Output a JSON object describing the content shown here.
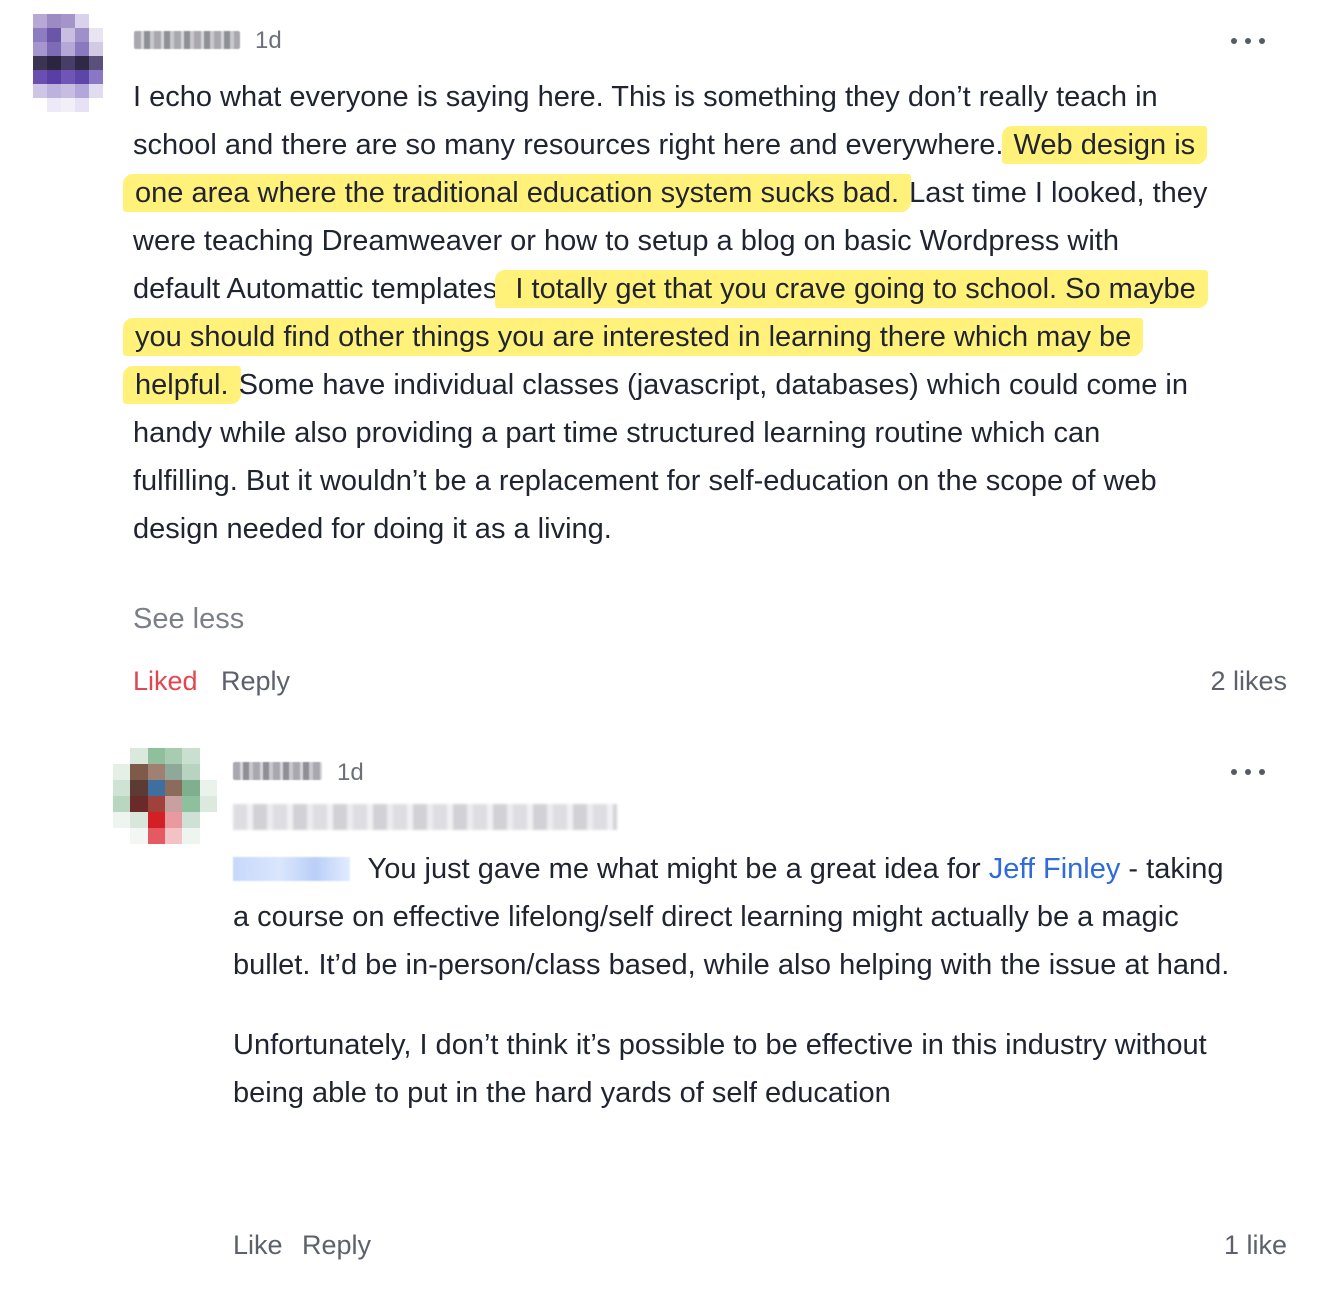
{
  "comments": [
    {
      "timestamp": "1d",
      "body": {
        "p1": "I echo what everyone is saying here. This is something they don’t really teach in school and there are so many resources right here and everywhere. ",
        "h1": "Web design is one area where the traditional education system sucks bad.",
        "p2": " Last time I looked, they were teaching Dreamweaver or how to setup a blog on basic Wordpress with default Automattic templates.",
        "h2": " I totally get that you crave going to school. So maybe you should find other things you are interested in learning there which may be helpful.",
        "p3": " Some have individual classes (javascript, databases) which could come in handy while also providing a part time structured learning routine which can fulfilling. But it wouldn’t be a replacement for self-education on the scope of web design needed for doing it as a living."
      },
      "see_less": "See less",
      "like_label": "Liked",
      "reply_label": "Reply",
      "likes_count": "2 likes"
    },
    {
      "timestamp": "1d",
      "body": {
        "p1_before_link": " You just gave me what might be a great idea for ",
        "link": "Jeff Finley",
        "p1_after_link": " - taking a course on effective lifelong/self direct learning might actually be a magic bullet. It’d be in-person/class based, while also helping with the issue at hand.",
        "p2": "Unfortunately, I don’t think it’s possible to be effective in this industry without being able to put in the hard yards of self education"
      },
      "like_label": "Like",
      "reply_label": "Reply",
      "likes_count": "1 like"
    }
  ],
  "colors": {
    "highlight": "#fff17a",
    "liked": "#e0474f",
    "link": "#2f6bdb",
    "muted": "#5c616b"
  },
  "avatars": [
    {
      "cols": 5,
      "cells": [
        "#b7a9d4",
        "#9b8bc2",
        "#a494c9",
        "#d9d2ea",
        "#ffffff",
        "#8e7cc0",
        "#6a55a8",
        "#c8bfe0",
        "#9f91c8",
        "#e8e4f2",
        "#a796cd",
        "#7d6bb6",
        "#b6a8d6",
        "#8a79bf",
        "#d3cbe6",
        "#3c3552",
        "#2b2540",
        "#473d66",
        "#2f2945",
        "#59507b",
        "#6a4fb0",
        "#5a3ea6",
        "#6f55b5",
        "#5e45a8",
        "#8b78c4",
        "#cfc6e6",
        "#bdb1dd",
        "#c7bce2",
        "#b3a6d8",
        "#e2dcf0",
        "#ffffff",
        "#ede9f6",
        "#f2eff8",
        "#e6e1f3",
        "#ffffff"
      ]
    },
    {
      "cols": 6,
      "cells": [
        "#ffffff",
        "#d9e9dc",
        "#8fbf9c",
        "#a8ccb2",
        "#c9dfcf",
        "#ffffff",
        "#e4efe6",
        "#7d5a4a",
        "#a08070",
        "#90a89a",
        "#b8d4c0",
        "#ffffff",
        "#cfe3d4",
        "#5b3b34",
        "#3f6fa0",
        "#8b6b5b",
        "#7faf8d",
        "#e9f2eb",
        "#b9d6c1",
        "#6b2a2a",
        "#a0413c",
        "#c9a0a0",
        "#8fc09e",
        "#dbe9df",
        "#eef5f0",
        "#d9e6dc",
        "#d32027",
        "#e89aa0",
        "#cfe0d4",
        "#ffffff",
        "#ffffff",
        "#f3f7f4",
        "#e55a62",
        "#f2c2c5",
        "#eef5f0",
        "#ffffff"
      ]
    }
  ]
}
